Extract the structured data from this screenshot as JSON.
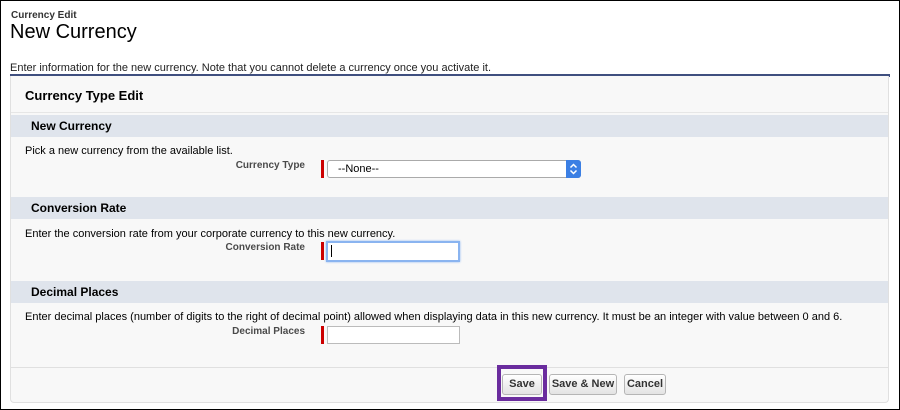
{
  "header": {
    "kicker": "Currency Edit",
    "title": "New Currency",
    "description": "Enter information for the new currency. Note that you cannot delete a currency once you activate it."
  },
  "panel": {
    "title": "Currency Type Edit"
  },
  "sections": {
    "new_currency": {
      "title": "New Currency",
      "help": "Pick a new currency from the available list.",
      "field_label": "Currency Type",
      "select_value": "--None--"
    },
    "conversion_rate": {
      "title": "Conversion Rate",
      "help": "Enter the conversion rate from your corporate currency to this new currency.",
      "field_label": "Conversion Rate",
      "input_value": ""
    },
    "decimal_places": {
      "title": "Decimal Places",
      "help": "Enter decimal places (number of digits to the right of decimal point) allowed when displaying data in this new currency. It must be an integer with value between 0 and 6.",
      "field_label": "Decimal Places",
      "input_value": ""
    }
  },
  "buttons": {
    "save": "Save",
    "save_new": "Save & New",
    "cancel": "Cancel"
  },
  "colors": {
    "header_rule": "#3f4f7f",
    "section_bar": "#dfe4ec",
    "required": "#cc0000",
    "highlight": "#6a2c9e",
    "select_button": "#3b7fe4"
  }
}
